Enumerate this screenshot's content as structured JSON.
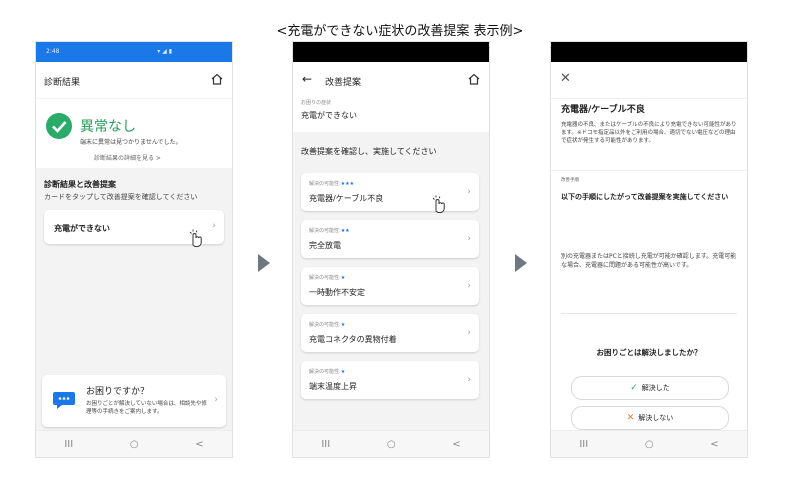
{
  "page": {
    "title": "<充電ができない症状の改善提案 表示例>"
  },
  "phone1": {
    "status_time": "2:48",
    "appbar_title": "診断結果",
    "result_title": "異常なし",
    "result_sub": "端末に異常は見つかりませんでした。",
    "detail_link": "診断結果の詳細を見る >",
    "section_title": "診断結果と改善提案",
    "section_sub": "カードをタップして改善提案を確認してください",
    "symptom_card": "充電ができない",
    "help_title": "お困りですか？",
    "help_sub": "お困りごとが解決していない場合は、相談先や修理等の手続きをご案内します。"
  },
  "phone2": {
    "appbar_title": "改善提案",
    "symptom_caption": "お困りの症状",
    "symptom": "充電ができない",
    "proposal_title": "改善提案を確認し、実施してください",
    "prob_label": "解決の可能性:",
    "proposals": [
      {
        "stars": "★★★",
        "name": "充電器/ケーブル不良"
      },
      {
        "stars": "★★",
        "name": "完全放電"
      },
      {
        "stars": "★",
        "name": "一時動作不安定"
      },
      {
        "stars": "★",
        "name": "充電コネクタの異物付着"
      },
      {
        "stars": "★",
        "name": "端末温度上昇"
      }
    ]
  },
  "phone3": {
    "title": "充電器/ケーブル不良",
    "desc": "充電器の不良、またはケーブルの不良により充電できない可能性があります。※ドコモ指定品以外をご利用の場合、適切でない電圧などの理由で症状が発生する可能性があります。",
    "steps_tag": "改善手順",
    "steps_title": "以下の手順にしたがって改善提案を実施してください",
    "steps_body": "別の充電器またはPCと接続し充電が可能か確認します。充電可能な場合、充電器に問題がある可能性が高いです。",
    "question": "お困りごとは解決しましたか？",
    "solved": "解決した",
    "not_solved": "解決しない"
  },
  "nav": {
    "recent": "III",
    "home": "○",
    "back": "<"
  },
  "colors": {
    "accent": "#1b78e8",
    "ok": "#2bab6a",
    "ng": "#e6782a"
  }
}
